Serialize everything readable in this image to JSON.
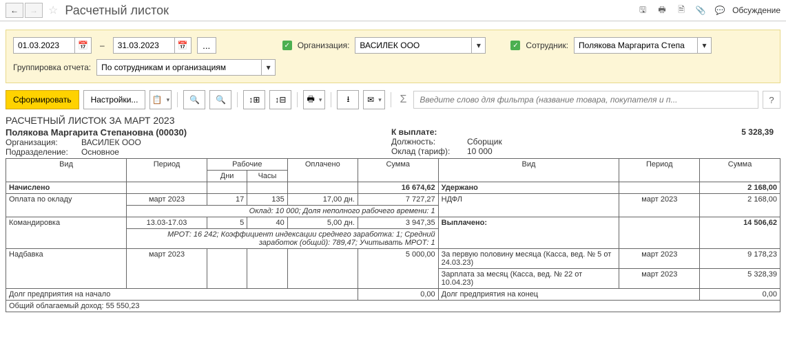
{
  "header": {
    "title": "Расчетный листок",
    "discuss": "Обсуждение"
  },
  "filters": {
    "date_from": "01.03.2023",
    "date_to": "31.03.2023",
    "org_label": "Организация:",
    "org_value": "ВАСИЛЕК ООО",
    "emp_label": "Сотрудник:",
    "emp_value": "Полякова Маргарита Степа",
    "group_label": "Группировка отчета:",
    "group_value": "По сотрудникам и организациям"
  },
  "toolbar": {
    "form": "Сформировать",
    "settings": "Настройки...",
    "search_placeholder": "Введите слово для фильтра (название товара, покупателя и п..."
  },
  "report": {
    "title": "РАСЧЕТНЫЙ ЛИСТОК ЗА МАРТ 2023",
    "employee": "Полякова Маргарита Степановна (00030)",
    "org_label": "Организация:",
    "org": "ВАСИЛЕК ООО",
    "dept_label": "Подразделение:",
    "dept": "Основное",
    "paylabel": "К выплате:",
    "payvalue": "5 328,39",
    "pos_label": "Должность:",
    "pos": "Сборщик",
    "sal_label": "Оклад (тариф):",
    "sal": "10 000",
    "cols": {
      "vid": "Вид",
      "period": "Период",
      "work": "Рабочие",
      "paid": "Оплачено",
      "sum": "Сумма",
      "days": "Дни",
      "hours": "Часы"
    },
    "accrued_label": "Начислено",
    "accrued_total": "16 674,62",
    "withheld_label": "Удержано",
    "withheld_total": "2 168,00",
    "paid_label": "Выплачено:",
    "paid_total": "14 506,62",
    "accrued": [
      {
        "name": "Оплата по окладу",
        "period": "март 2023",
        "days": "17",
        "hours": "135",
        "paid": "17,00 дн.",
        "sum": "7 727,27",
        "note": "Оклад: 10 000; Доля неполного рабочего времени: 1"
      },
      {
        "name": "Командировка",
        "period": "13.03-17.03",
        "days": "5",
        "hours": "40",
        "paid": "5,00 дн.",
        "sum": "3 947,35",
        "note": "МРОТ: 16 242; Коэффициент индексации среднего заработка: 1; Средний заработок (общий): 789,47; Учитывать МРОТ: 1"
      },
      {
        "name": "Надбавка",
        "period": "март 2023",
        "days": "",
        "hours": "",
        "paid": "",
        "sum": "5 000,00",
        "note": ""
      }
    ],
    "withheld": [
      {
        "name": "НДФЛ",
        "period": "март 2023",
        "sum": "2 168,00"
      }
    ],
    "payments": [
      {
        "name": "За первую половину месяца (Касса, вед. № 5 от 24.03.23)",
        "period": "март 2023",
        "sum": "9 178,23"
      },
      {
        "name": "Зарплата за месяц (Касса, вед. № 22 от 10.04.23)",
        "period": "март 2023",
        "sum": "5 328,39"
      }
    ],
    "debt_start_label": "Долг предприятия на начало",
    "debt_start": "0,00",
    "debt_end_label": "Долг предприятия на конец",
    "debt_end": "0,00",
    "taxable_label": "Общий облагаемый доход:",
    "taxable": "55 550,23"
  }
}
